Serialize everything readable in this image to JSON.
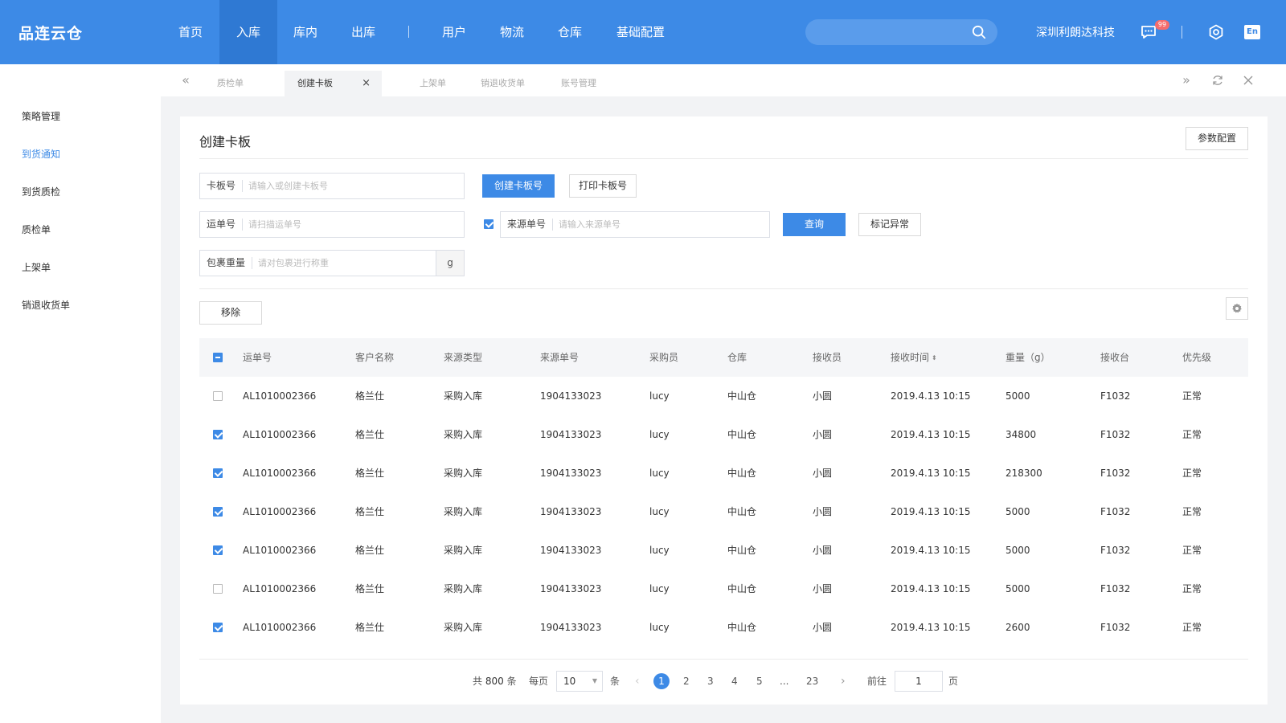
{
  "app": {
    "logo": "品连云仓"
  },
  "topnav": {
    "items": [
      {
        "label": "首页"
      },
      {
        "label": "入库",
        "active": true
      },
      {
        "label": "库内"
      },
      {
        "label": "出库"
      },
      {
        "label": "用户"
      },
      {
        "label": "物流"
      },
      {
        "label": "仓库"
      },
      {
        "label": "基础配置"
      }
    ],
    "search_placeholder": "",
    "company": "深圳利朗达科技",
    "message_badge": "99",
    "lang": "En"
  },
  "colors": {
    "primary": "#3d8ae6",
    "active_nav": "#2f79d3",
    "badge": "#f56c6c"
  },
  "sidebar": {
    "items": [
      {
        "label": "策略管理"
      },
      {
        "label": "到货通知",
        "active": true
      },
      {
        "label": "到货质检"
      },
      {
        "label": "质检单"
      },
      {
        "label": "上架单"
      },
      {
        "label": "销退收货单"
      }
    ]
  },
  "tabs": {
    "items": [
      {
        "label": "质检单"
      },
      {
        "label": "创建卡板",
        "active": true
      },
      {
        "label": "上架单"
      },
      {
        "label": "销退收货单"
      },
      {
        "label": "账号管理"
      }
    ],
    "close_symbol": "×"
  },
  "page": {
    "title": "创建卡板",
    "param_button": "参数配置",
    "pallet_label": "卡板号",
    "pallet_placeholder": "请输入或创建卡板号",
    "create_pallet_button": "创建卡板号",
    "print_pallet_button": "打印卡板号",
    "waybill_label": "运单号",
    "waybill_placeholder": "请扫描运单号",
    "source_label": "来源单号",
    "source_placeholder": "请输入来源单号",
    "source_checked": true,
    "query_button": "查询",
    "mark_exception_button": "标记异常",
    "weight_label": "包裹重量",
    "weight_placeholder": "请对包裹进行称重",
    "weight_unit": "g",
    "remove_button": "移除"
  },
  "table": {
    "columns": [
      "运单号",
      "客户名称",
      "来源类型",
      "来源单号",
      "采购员",
      "仓库",
      "接收员",
      "接收时间",
      "重量（g）",
      "接收台",
      "优先级"
    ],
    "sort_symbol": "⬍",
    "rows": [
      {
        "checked": false,
        "cells": [
          "AL1010002366",
          "格兰仕",
          "采购入库",
          "1904133023",
          "lucy",
          "中山仓",
          "小圆",
          "2019.4.13 10:15",
          "5000",
          "F1032",
          "正常"
        ]
      },
      {
        "checked": true,
        "cells": [
          "AL1010002366",
          "格兰仕",
          "采购入库",
          "1904133023",
          "lucy",
          "中山仓",
          "小圆",
          "2019.4.13 10:15",
          "34800",
          "F1032",
          "正常"
        ]
      },
      {
        "checked": true,
        "cells": [
          "AL1010002366",
          "格兰仕",
          "采购入库",
          "1904133023",
          "lucy",
          "中山仓",
          "小圆",
          "2019.4.13 10:15",
          "218300",
          "F1032",
          "正常"
        ]
      },
      {
        "checked": true,
        "cells": [
          "AL1010002366",
          "格兰仕",
          "采购入库",
          "1904133023",
          "lucy",
          "中山仓",
          "小圆",
          "2019.4.13 10:15",
          "5000",
          "F1032",
          "正常"
        ]
      },
      {
        "checked": true,
        "cells": [
          "AL1010002366",
          "格兰仕",
          "采购入库",
          "1904133023",
          "lucy",
          "中山仓",
          "小圆",
          "2019.4.13 10:15",
          "5000",
          "F1032",
          "正常"
        ]
      },
      {
        "checked": false,
        "cells": [
          "AL1010002366",
          "格兰仕",
          "采购入库",
          "1904133023",
          "lucy",
          "中山仓",
          "小圆",
          "2019.4.13 10:15",
          "5000",
          "F1032",
          "正常"
        ]
      },
      {
        "checked": true,
        "cells": [
          "AL1010002366",
          "格兰仕",
          "采购入库",
          "1904133023",
          "lucy",
          "中山仓",
          "小圆",
          "2019.4.13 10:15",
          "2600",
          "F1032",
          "正常"
        ]
      }
    ]
  },
  "pagination": {
    "total_prefix": "共",
    "total": "800",
    "total_suffix": "条",
    "per_page_label": "每页",
    "per_page_value": "10",
    "per_page_suffix": "条",
    "pages": [
      "1",
      "2",
      "3",
      "4",
      "5",
      "...",
      "23"
    ],
    "current_page": "1",
    "goto_label": "前往",
    "goto_value": "1",
    "goto_suffix": "页",
    "prev_symbol": "‹",
    "next_symbol": "›"
  }
}
